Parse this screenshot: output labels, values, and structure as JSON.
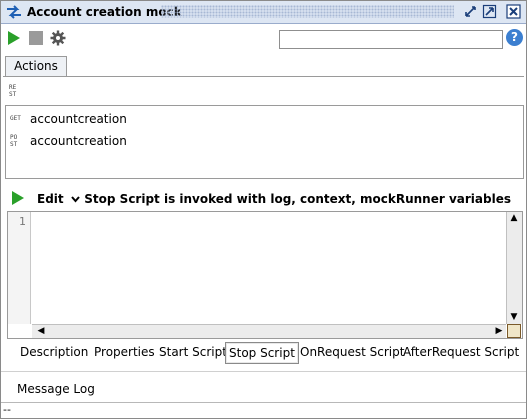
{
  "window": {
    "title": "Account creation mock",
    "icon": "mock-service-icon"
  },
  "window_controls": [
    "restore-icon",
    "maximize-icon",
    "close-icon"
  ],
  "toolbar": {
    "run_icon": "play-icon",
    "stop_icon": "stop-icon",
    "settings_icon": "gear-icon",
    "search_value": "",
    "help_label": "?"
  },
  "tabs": [
    {
      "label": "Actions",
      "selected": true
    }
  ],
  "rest_badge": "RE\nST",
  "actions": [
    {
      "method_badge": "GET",
      "label": "accountcreation"
    },
    {
      "method_badge": "PO\nST",
      "label": "accountcreation"
    }
  ],
  "script": {
    "edit_label": "Edit",
    "description": "Stop Script is invoked with log, context, mockRunner variables",
    "line_numbers": [
      "1"
    ],
    "content": ""
  },
  "bottom_tabs": [
    {
      "label": "Description",
      "active": false
    },
    {
      "label": "Properties",
      "active": false
    },
    {
      "label": "Start Script",
      "active": false
    },
    {
      "label": "Stop Script",
      "active": true
    },
    {
      "label": "OnRequest Script",
      "active": false
    },
    {
      "label": "AfterRequest Script",
      "active": false
    }
  ],
  "message_log": {
    "label": "Message Log"
  },
  "status": {
    "text": "--"
  },
  "colors": {
    "title_bar_bg": "#dde6f3",
    "play_green": "#2aa02a",
    "help_blue": "#3c7fd0"
  }
}
